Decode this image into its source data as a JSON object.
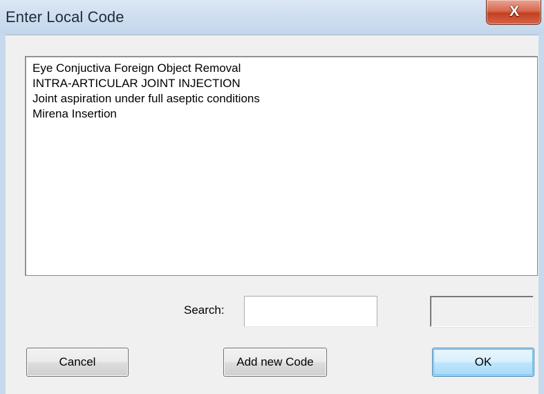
{
  "window": {
    "title": "Enter Local Code",
    "close_glyph": "X"
  },
  "list": {
    "items": [
      "Eye Conjuctiva Foreign Object Removal",
      "INTRA-ARTICULAR JOINT INJECTION",
      "Joint aspiration under full aseptic conditions",
      "Mirena Insertion"
    ]
  },
  "search": {
    "label": "Search:",
    "value": ""
  },
  "code_field": {
    "value": ""
  },
  "buttons": {
    "cancel": "Cancel",
    "add_new_code": "Add new Code",
    "ok": "OK"
  },
  "colors": {
    "titlebar": "#cfdfef",
    "close_button": "#c4401f",
    "dialog_background": "#f0f0f0",
    "default_button_border": "#3c7fb1"
  }
}
